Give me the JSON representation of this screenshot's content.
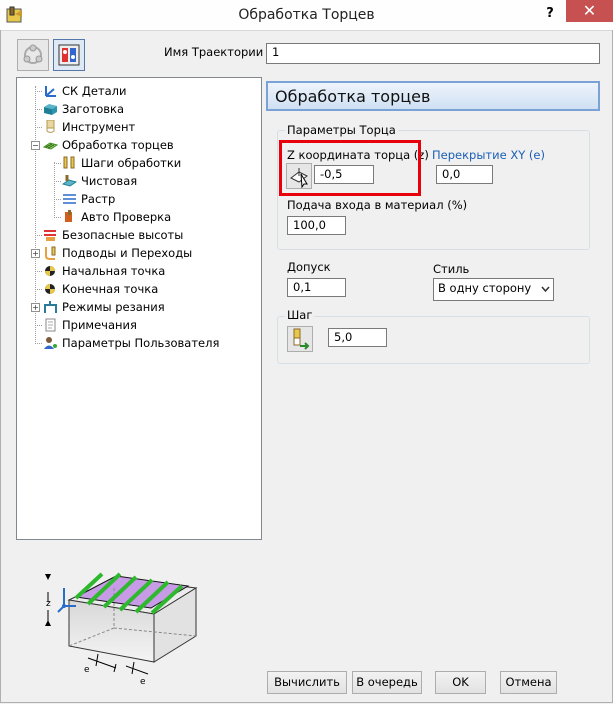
{
  "window": {
    "title": "Обработка Торцев",
    "help": "?",
    "close": "✕"
  },
  "trajectory": {
    "label": "Имя Траектории",
    "value": "1"
  },
  "tree": {
    "items": [
      {
        "label": "СК Детали",
        "icon": "axes-icon",
        "level": 0
      },
      {
        "label": "Заготовка",
        "icon": "stock-block-icon",
        "level": 0
      },
      {
        "label": "Инструмент",
        "icon": "tool-icon",
        "level": 0
      },
      {
        "label": "Обработка торцев",
        "icon": "face-milling-icon",
        "level": 0
      },
      {
        "label": "Шаги обработки",
        "icon": "step-down-icon",
        "level": 1
      },
      {
        "label": "Чистовая",
        "icon": "finishing-icon",
        "level": 1
      },
      {
        "label": "Растр",
        "icon": "raster-icon",
        "level": 1
      },
      {
        "label": "Авто Проверка",
        "icon": "auto-check-icon",
        "level": 1
      },
      {
        "label": "Безопасные высоты",
        "icon": "safe-heights-icon",
        "level": 0
      },
      {
        "label": "Подводы и Переходы",
        "icon": "leads-links-icon",
        "level": 0
      },
      {
        "label": "Начальная точка",
        "icon": "start-point-icon",
        "level": 0
      },
      {
        "label": "Конечная точка",
        "icon": "end-point-icon",
        "level": 0
      },
      {
        "label": "Режимы резания",
        "icon": "feeds-speeds-icon",
        "level": 0
      },
      {
        "label": "Примечания",
        "icon": "notes-icon",
        "level": 0
      },
      {
        "label": "Параметры Пользователя",
        "icon": "user-params-icon",
        "level": 0
      }
    ]
  },
  "panel": {
    "header": "Обработка торцев",
    "face_group": {
      "title": "Параметры Торца",
      "z_label": "Z координата торца (z)",
      "z_value": "-0,5",
      "overlap_label": "Перекрытие XY (e)",
      "overlap_value": "0,0",
      "feed_label": "Подача входа в материал (%)",
      "feed_value": "100,0"
    },
    "tolerance_label": "Допуск",
    "tolerance_value": "0,1",
    "style_label": "Стиль",
    "style_value": "В одну сторону",
    "step_group": {
      "title": "Шаг",
      "value": "5,0"
    }
  },
  "diagram": {
    "z_label": "z",
    "e_label_1": "e",
    "e_label_2": "e"
  },
  "buttons": {
    "calculate": "Вычислить",
    "queue": "В очередь",
    "ok": "OK",
    "cancel": "Отмена"
  },
  "colors": {
    "header_border": "#7aa2d6",
    "highlight": "#e8000b",
    "link_text": "#1a5fb4",
    "close_button": "#c75050"
  }
}
